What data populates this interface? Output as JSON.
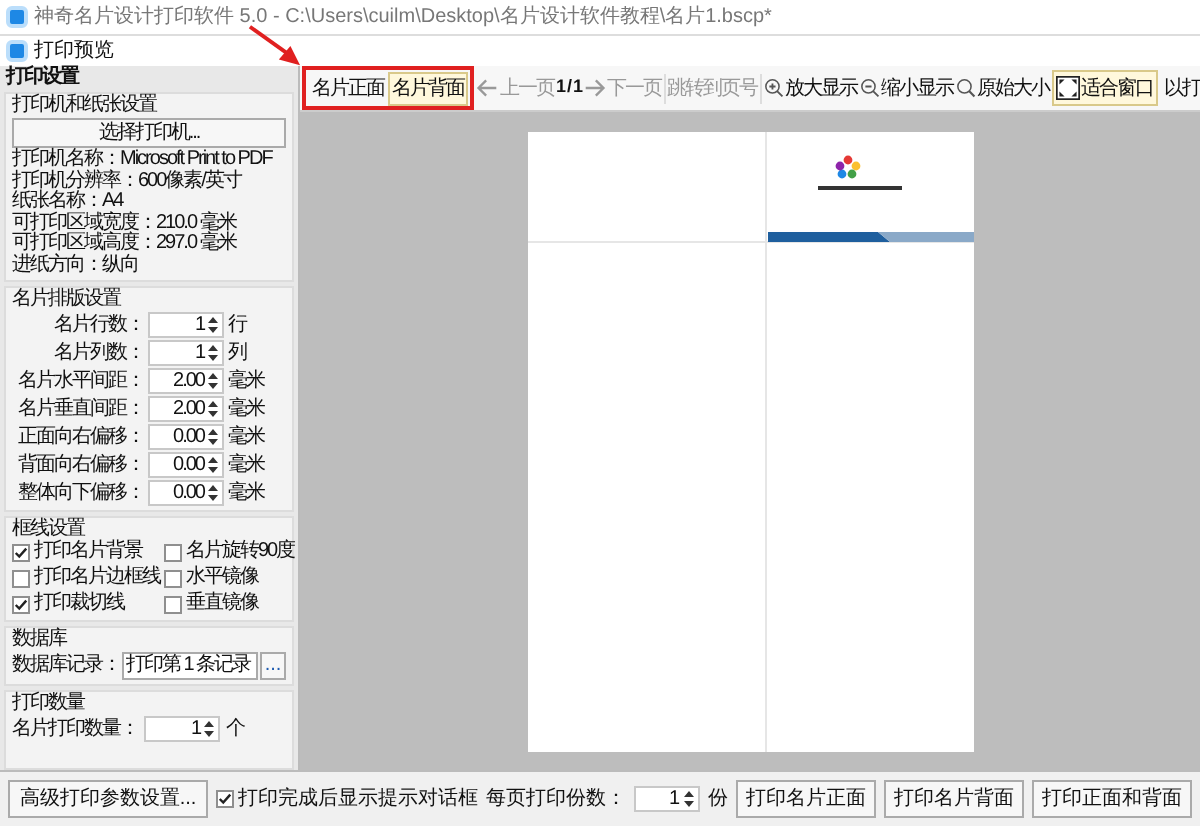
{
  "app_title": "神奇名片设计打印软件 5.0 - C:\\Users\\cuilm\\Desktop\\名片设计软件教程\\名片1.bscp*",
  "dialog_title": "打印预览",
  "left_panel": {
    "title": "打印设置",
    "printer_group": {
      "title": "打印机和纸张设置",
      "button": "选择打印机...",
      "info": [
        "打印机名称：Microsoft Print to PDF",
        "打印机分辨率：600像素/英寸",
        "纸张名称：A4",
        "可打印区域宽度：210.0 毫米",
        "可打印区域高度：297.0 毫米",
        "进纸方向：纵向"
      ]
    },
    "layout_group": {
      "title": "名片排版设置",
      "rows": [
        {
          "label": "名片行数：",
          "value": "1",
          "unit": "行"
        },
        {
          "label": "名片列数：",
          "value": "1",
          "unit": "列"
        },
        {
          "label": "名片水平间距：",
          "value": "2.00",
          "unit": "毫米"
        },
        {
          "label": "名片垂直间距：",
          "value": "2.00",
          "unit": "毫米"
        },
        {
          "label": "正面向右偏移：",
          "value": "0.00",
          "unit": "毫米"
        },
        {
          "label": "背面向右偏移：",
          "value": "0.00",
          "unit": "毫米"
        },
        {
          "label": "整体向下偏移：",
          "value": "0.00",
          "unit": "毫米"
        }
      ]
    },
    "options_group": {
      "title": "框线设置",
      "options": [
        {
          "label": "打印名片背景",
          "checked": true
        },
        {
          "label": "名片旋转90度",
          "checked": false
        },
        {
          "label": "打印名片边框线",
          "checked": false
        },
        {
          "label": "水平镜像",
          "checked": false
        },
        {
          "label": "打印裁切线",
          "checked": true
        },
        {
          "label": "垂直镜像",
          "checked": false
        }
      ]
    },
    "database_group": {
      "title": "数据库",
      "label": "数据库记录：",
      "value": "打印第 1 条记录",
      "button": "..."
    },
    "quantity_group": {
      "title": "打印数量",
      "label": "名片打印数量：",
      "value": "1",
      "unit": "个"
    }
  },
  "toolbar": [
    {
      "kind": "tab",
      "label": "名片正面",
      "selected": false
    },
    {
      "kind": "tab",
      "label": "名片背面",
      "selected": true
    },
    {
      "kind": "prev",
      "label": "上一页",
      "disabled": true
    },
    {
      "kind": "page",
      "label": "1 / 1"
    },
    {
      "kind": "next",
      "label": "下一页",
      "disabled": true
    },
    {
      "kind": "plain",
      "label": "跳转到页号",
      "disabled": true
    },
    {
      "kind": "zoom-in",
      "label": "放大显示",
      "disabled": false
    },
    {
      "kind": "zoom-out",
      "label": "缩小显示",
      "disabled": false
    },
    {
      "kind": "actual",
      "label": "原始大小",
      "disabled": false
    },
    {
      "kind": "fit",
      "label": "适合窗口",
      "selected": true
    },
    {
      "kind": "cut",
      "label": "以打"
    }
  ],
  "bottom_bar": {
    "advanced_button": "高级打印参数设置...",
    "show_dialog": {
      "label": "打印完成后显示提示对话框",
      "checked": true
    },
    "copies": {
      "label": "每页打印份数：",
      "value": "1",
      "unit": "份"
    },
    "buttons": [
      "打印名片正面",
      "打印名片背面",
      "打印正面和背面"
    ]
  }
}
